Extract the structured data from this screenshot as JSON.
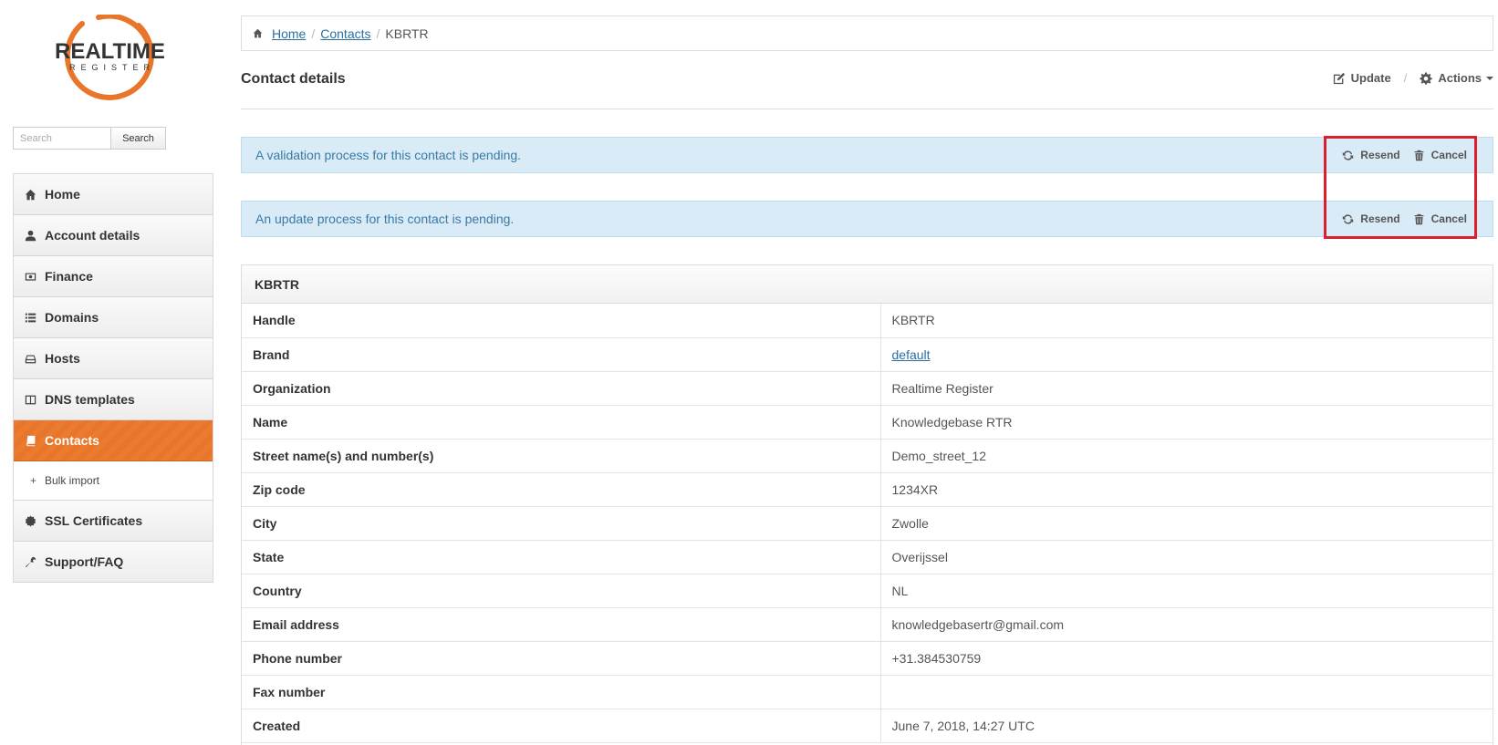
{
  "logo": {
    "title": "REALTIME",
    "subtitle": "REGISTER"
  },
  "search": {
    "placeholder": "Search",
    "button_label": "Search"
  },
  "sidebar": {
    "items": [
      {
        "label": "Home",
        "icon": "home-icon"
      },
      {
        "label": "Account details",
        "icon": "user-icon"
      },
      {
        "label": "Finance",
        "icon": "money-icon"
      },
      {
        "label": "Domains",
        "icon": "list-icon"
      },
      {
        "label": "Hosts",
        "icon": "server-icon"
      },
      {
        "label": "DNS templates",
        "icon": "columns-icon"
      },
      {
        "label": "Contacts",
        "icon": "book-icon",
        "active": true
      },
      {
        "label": "SSL Certificates",
        "icon": "certificate-icon"
      },
      {
        "label": "Support/FAQ",
        "icon": "wrench-icon"
      }
    ],
    "sub_items": [
      {
        "label": "Bulk import",
        "prefix": "+"
      }
    ]
  },
  "breadcrumb": {
    "home": "Home",
    "contacts": "Contacts",
    "current": "KBRTR",
    "separator": "/"
  },
  "header": {
    "title": "Contact details",
    "update_label": "Update",
    "actions_label": "Actions",
    "separator": "/"
  },
  "alerts": [
    {
      "text": "A validation process for this contact is pending.",
      "resend": "Resend",
      "cancel": "Cancel"
    },
    {
      "text": "An update process for this contact is pending.",
      "resend": "Resend",
      "cancel": "Cancel"
    }
  ],
  "panel": {
    "title": "KBRTR",
    "rows": [
      {
        "key": "Handle",
        "value": "KBRTR"
      },
      {
        "key": "Brand",
        "value": "default"
      },
      {
        "key": "Organization",
        "value": "Realtime Register"
      },
      {
        "key": "Name",
        "value": "Knowledgebase RTR"
      },
      {
        "key": "Street name(s) and number(s)",
        "value": "Demo_street_12"
      },
      {
        "key": "Zip code",
        "value": "1234XR"
      },
      {
        "key": "City",
        "value": "Zwolle"
      },
      {
        "key": "State",
        "value": "Overijssel"
      },
      {
        "key": "Country",
        "value": "NL"
      },
      {
        "key": "Email address",
        "value": "knowledgebasertr@gmail.com"
      },
      {
        "key": "Phone number",
        "value": "+31.384530759"
      },
      {
        "key": "Fax number",
        "value": ""
      },
      {
        "key": "Created",
        "value": "June 7, 2018, 14:27 UTC"
      }
    ]
  },
  "colors": {
    "accent": "#e8752a",
    "alert_bg": "#d9ebf7",
    "alert_text": "#3a7aa5",
    "highlight": "#dc1f2c",
    "link": "#2a6fa0"
  }
}
